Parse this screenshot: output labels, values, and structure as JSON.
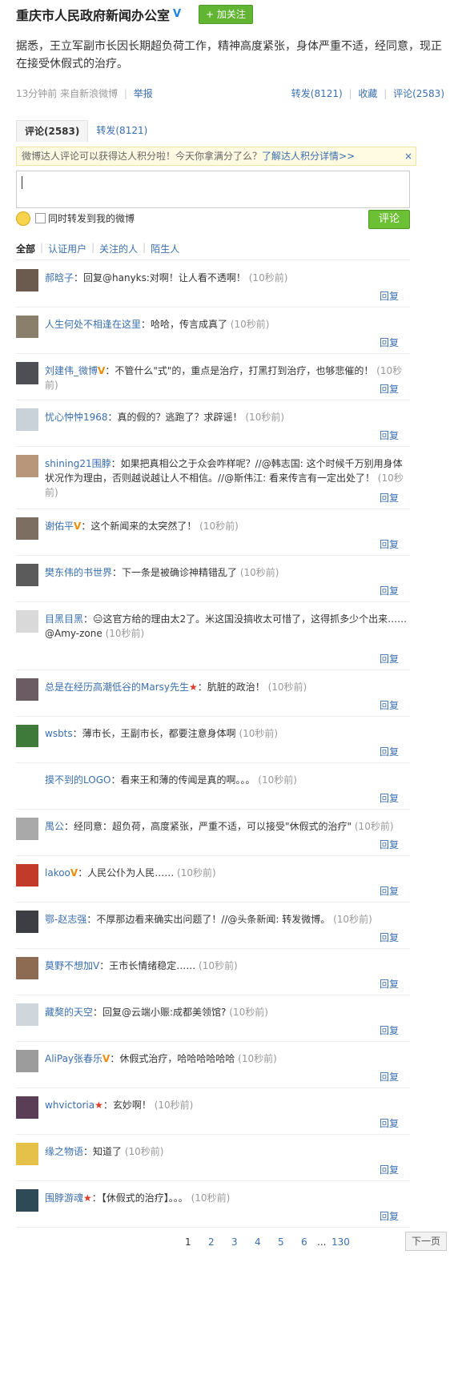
{
  "header": {
    "title": "重庆市人民政府新闻办公室",
    "verified": "V",
    "follow_label": "+ 加关注"
  },
  "post": {
    "text": "据悉，王立军副市长因长期超负荷工作，精神高度紧张，身体严重不适，经同意，现正在接受休假式的治疗。"
  },
  "meta": {
    "time_source": "13分钟前 来自新浪微博",
    "report": "举报",
    "repost": "转发(8121)",
    "favorite": "收藏",
    "comment": "评论(2583)"
  },
  "tabs": {
    "comments": "评论(2583)",
    "reposts": "转发(8121)"
  },
  "notice": {
    "text": "微博达人评论可以获得达人积分啦！今天你拿满分了么？",
    "link": "了解达人积分详情>>",
    "close": "×"
  },
  "compose": {
    "checkbox_label": "同时转发到我的微博",
    "submit": "评论"
  },
  "filters": {
    "all": "全部",
    "verified": "认证用户",
    "following": "关注的人",
    "stranger": "陌生人"
  },
  "reply_label": "回复",
  "comments": [
    {
      "user": "郝晗子",
      "badge": "",
      "avatar_color": "#6b5a4e",
      "text": "：回复@hanyks:对啊！让人看不透啊！",
      "time": "(10秒前)"
    },
    {
      "user": "人生何处不相逢在这里",
      "badge": "",
      "avatar_color": "#8a7f6a",
      "text": "：哈哈，传言成真了",
      "time": "(10秒前)"
    },
    {
      "user": "刘建伟_微博",
      "badge": "V",
      "avatar_color": "#4e4e55",
      "text": "：不管什么\"式\"的，重点是治疗，打黑打到治疗，也够悲催的！",
      "time": "(10秒前)"
    },
    {
      "user": "忧心忡忡1968",
      "badge": "",
      "avatar_color": "#c9d2d8",
      "text": "：真的假的？逃跑了？求辟谣！",
      "time": "(10秒前)"
    },
    {
      "user": "shining21围脖",
      "badge": "",
      "avatar_color": "#b8967a",
      "text": "：如果把真相公之于众会咋样呢？//@韩志国: 这个时候千万别用身体状况作为理由，否则越说越让人不相信。//@斯伟江: 看来传言有一定出处了！",
      "time": "(10秒前)"
    },
    {
      "user": "谢佑平",
      "badge": "V",
      "avatar_color": "#7d6e62",
      "text": "：这个新闻来的太突然了！",
      "time": "(10秒前)"
    },
    {
      "user": "樊东伟的书世界",
      "badge": "",
      "avatar_color": "#5b5b5b",
      "text": "：下一条是被确诊神精错乱了",
      "time": "(10秒前)"
    },
    {
      "user": "目黑目黑",
      "badge": "",
      "avatar_color": "#d9d9d9",
      "text": "：😑这官方给的理由太2了。米这国没搞收太可惜了，这得抓多少个出来……@Amy-zone",
      "time": "(10秒前)"
    },
    {
      "user": "总是在经历高潮低谷的Marsy先生",
      "badge": "★",
      "avatar_color": "#6a5c62",
      "text": "：肮脏的政治！",
      "time": "(10秒前)"
    },
    {
      "user": "wsbts",
      "badge": "",
      "avatar_color": "#3f7a3a",
      "text": "：薄市长，王副市长，都要注意身体啊",
      "time": "(10秒前)"
    },
    {
      "user": "摸不到的LOGO",
      "badge": "",
      "avatar_color": "#ffffff",
      "text": "：看来王和薄的传闻是真的啊。。。",
      "time": "(10秒前)"
    },
    {
      "user": "禺公",
      "badge": "",
      "avatar_color": "#a9a9a9",
      "text": "：经同意：超负荷，高度紧张，严重不适，可以接受\"休假式的治疗\"",
      "time": "(10秒前)"
    },
    {
      "user": "lakoo",
      "badge": "V",
      "avatar_color": "#c23a2a",
      "text": "：人民公仆为人民……",
      "time": "(10秒前)"
    },
    {
      "user": "鄂-赵志强",
      "badge": "",
      "avatar_color": "#3d3d44",
      "text": "：不厚那边看来确实出问题了！//@头条新闻: 转发微博。",
      "time": "(10秒前)"
    },
    {
      "user": "莫野不想加V",
      "badge": "",
      "avatar_color": "#8d6b52",
      "text": "：王市长情绪稳定……",
      "time": "(10秒前)"
    },
    {
      "user": "藏獒的天空",
      "badge": "",
      "avatar_color": "#cfd6dc",
      "text": "：回复@云端小赈:成都美领馆?",
      "time": "(10秒前)"
    },
    {
      "user": "AliPay张春乐",
      "badge": "V",
      "avatar_color": "#9c9c9c",
      "text": "：休假式治疗，哈哈哈哈哈哈",
      "time": "(10秒前)"
    },
    {
      "user": "whvictoria",
      "badge": "★",
      "avatar_color": "#5a3e55",
      "text": "：玄妙啊！",
      "time": "(10秒前)"
    },
    {
      "user": "缘之物语",
      "badge": "",
      "avatar_color": "#e6c14a",
      "text": "：知道了",
      "time": "(10秒前)"
    },
    {
      "user": "围脖游魂",
      "badge": "★",
      "avatar_color": "#2e4a56",
      "text": "：【休假式的治疗】。。。",
      "time": "(10秒前)"
    }
  ],
  "pager": {
    "pages": [
      "1",
      "2",
      "3",
      "4",
      "5",
      "6"
    ],
    "ellipsis": "...",
    "last": "130",
    "next": "下一页"
  }
}
